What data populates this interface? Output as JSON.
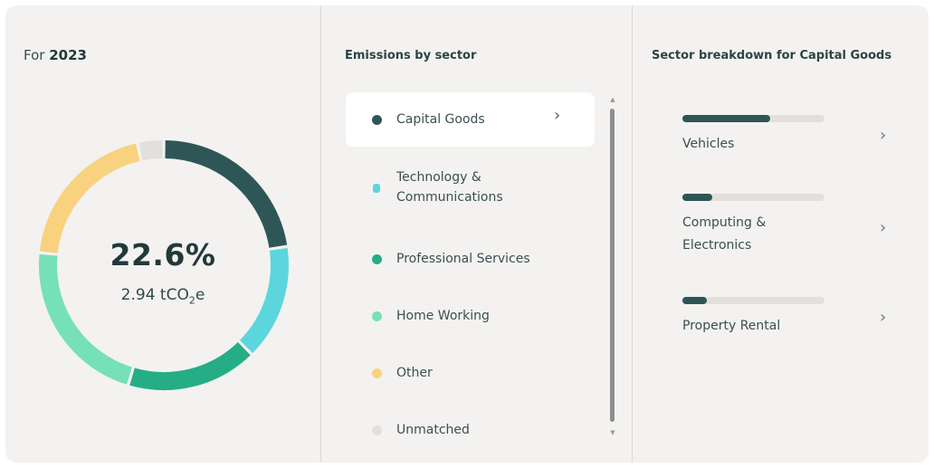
{
  "summary": {
    "for_prefix": "For",
    "year": "2023",
    "percent": "22.6%",
    "value": "2.94 tCO",
    "value_sub": "2",
    "value_suffix": "e"
  },
  "donut": {
    "segments": [
      {
        "sector": "Capital Goods",
        "fraction": 0.226,
        "color": "#2f5657"
      },
      {
        "sector": "Technology & Communications",
        "fraction": 0.15,
        "color": "#5bd6dc"
      },
      {
        "sector": "Professional Services",
        "fraction": 0.17,
        "color": "#25ad86"
      },
      {
        "sector": "Home Working",
        "fraction": 0.22,
        "color": "#76e0b8"
      },
      {
        "sector": "Other",
        "fraction": 0.2,
        "color": "#f9d27f"
      },
      {
        "sector": "Unmatched",
        "fraction": 0.034,
        "color": "#e2e0dd"
      }
    ]
  },
  "sectors": {
    "heading": "Emissions by sector",
    "items": [
      {
        "label": "Capital Goods",
        "color": "#2f5657",
        "active": true
      },
      {
        "label_line1": "Technology &",
        "label_line2": "Communications",
        "color": "#5bd6dc",
        "active": false
      },
      {
        "label": "Professional Services",
        "color": "#25ad86",
        "active": false
      },
      {
        "label": "Home Working",
        "color": "#76e0b8",
        "active": false
      },
      {
        "label": "Other",
        "color": "#f9d27f",
        "active": false
      },
      {
        "label": "Unmatched",
        "color": "#e2e0dd",
        "active": false
      }
    ]
  },
  "breakdown": {
    "heading": "Sector breakdown for Capital Goods",
    "items": [
      {
        "label": "Vehicles",
        "share": 0.62
      },
      {
        "label_line1": "Computing &",
        "label_line2": "Electronics",
        "share": 0.21
      },
      {
        "label": "Property Rental",
        "share": 0.17
      }
    ]
  },
  "icons": {
    "chevron": "›",
    "scroll_up": "▲",
    "scroll_down": "▼"
  }
}
